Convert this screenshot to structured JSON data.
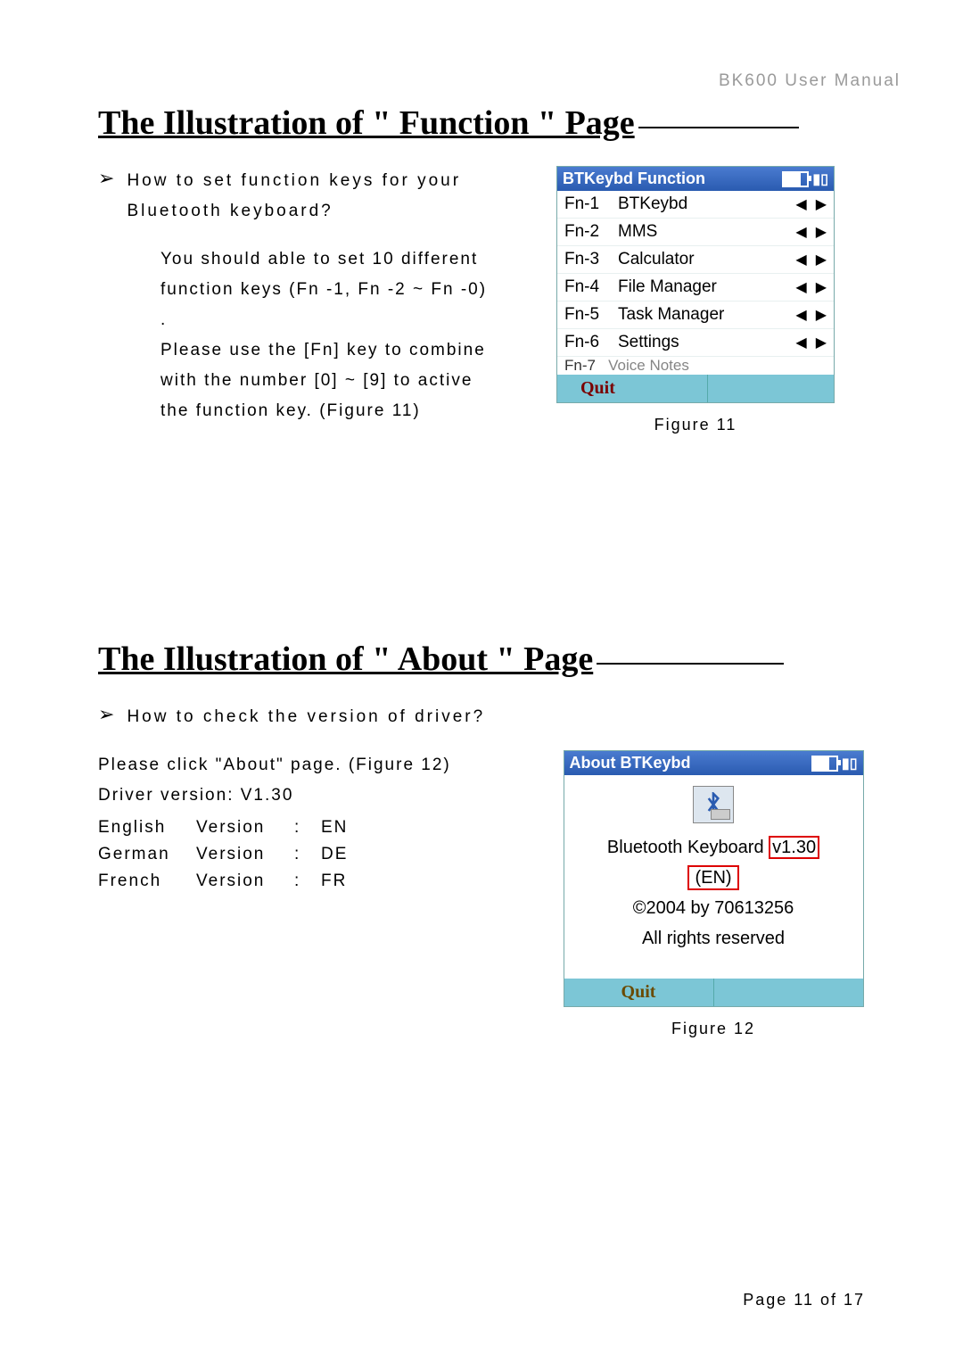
{
  "header": {
    "doc_title": "BK600 User Manual"
  },
  "section1": {
    "title": "The Illustration of \" Function \" Page",
    "question": "How to set function keys for your Bluetooth keyboard?",
    "body": "You should able to set 10 different function keys (Fn -1, Fn -2 ~ Fn -0) .\nPlease use the [Fn] key to combine with the number [0] ~ [9] to active the function key. (Figure 11)",
    "figure_caption": "Figure 11",
    "screenshot": {
      "title": "BTKeybd Function",
      "rows": [
        {
          "key": "Fn-1",
          "value": "BTKeybd"
        },
        {
          "key": "Fn-2",
          "value": "MMS"
        },
        {
          "key": "Fn-3",
          "value": "Calculator"
        },
        {
          "key": "Fn-4",
          "value": "File Manager"
        },
        {
          "key": "Fn-5",
          "value": "Task Manager"
        },
        {
          "key": "Fn-6",
          "value": "Settings"
        }
      ],
      "cut_row": {
        "key": "Fn-7",
        "value": "Voice Notes"
      },
      "quit": "Quit"
    }
  },
  "section2": {
    "title": "The Illustration of \" About \" Page",
    "question": "How to check the version of driver?",
    "body_line1": "Please click \"About\" page. (Figure 12)",
    "body_line2": "Driver version: V1.30",
    "versions": [
      {
        "lang": "English",
        "word": "Version",
        "sep": ":",
        "code": "EN"
      },
      {
        "lang": "German",
        "word": "Version",
        "sep": ":",
        "code": "DE"
      },
      {
        "lang": "French",
        "word": "Version",
        "sep": ":",
        "code": "FR"
      }
    ],
    "figure_caption": "Figure 12",
    "screenshot": {
      "title": "About BTKeybd",
      "line1_pre": "Bluetooth Keyboard ",
      "version": "v1.30",
      "lang": "(EN)",
      "copyright": "©2004 by 70613256",
      "rights": "All rights reserved",
      "quit": "Quit"
    }
  },
  "footer": {
    "page": "Page 11 of 17"
  }
}
